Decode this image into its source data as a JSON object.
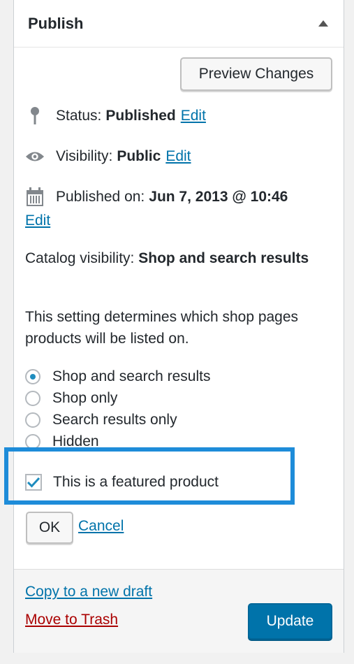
{
  "panel": {
    "title": "Publish",
    "toggle_icon": "triangle-up-icon"
  },
  "preview_button": "Preview Changes",
  "status": {
    "icon": "pin-icon",
    "label": "Status:",
    "value": "Published",
    "edit": "Edit"
  },
  "visibility": {
    "icon": "eye-icon",
    "label": "Visibility:",
    "value": "Public",
    "edit": "Edit"
  },
  "published_on": {
    "icon": "calendar-icon",
    "label": "Published on:",
    "value": "Jun 7, 2013 @ 10:46",
    "edit": "Edit"
  },
  "catalog": {
    "label": "Catalog visibility:",
    "value": "Shop and search results",
    "description": "This setting determines which shop pages products will be listed on.",
    "options": [
      {
        "label": "Shop and search results",
        "checked": true
      },
      {
        "label": "Shop only",
        "checked": false
      },
      {
        "label": "Search results only",
        "checked": false
      },
      {
        "label": "Hidden",
        "checked": false
      }
    ],
    "featured": {
      "label": "This is a featured product",
      "checked": true
    },
    "ok": "OK",
    "cancel": "Cancel"
  },
  "footer": {
    "copy_link": "Copy to a new draft",
    "trash_link": "Move to Trash",
    "update_button": "Update"
  },
  "colors": {
    "link": "#0073aa",
    "trash": "#aa0000",
    "primary": "#0073aa",
    "highlight": "#1e8cd9"
  }
}
